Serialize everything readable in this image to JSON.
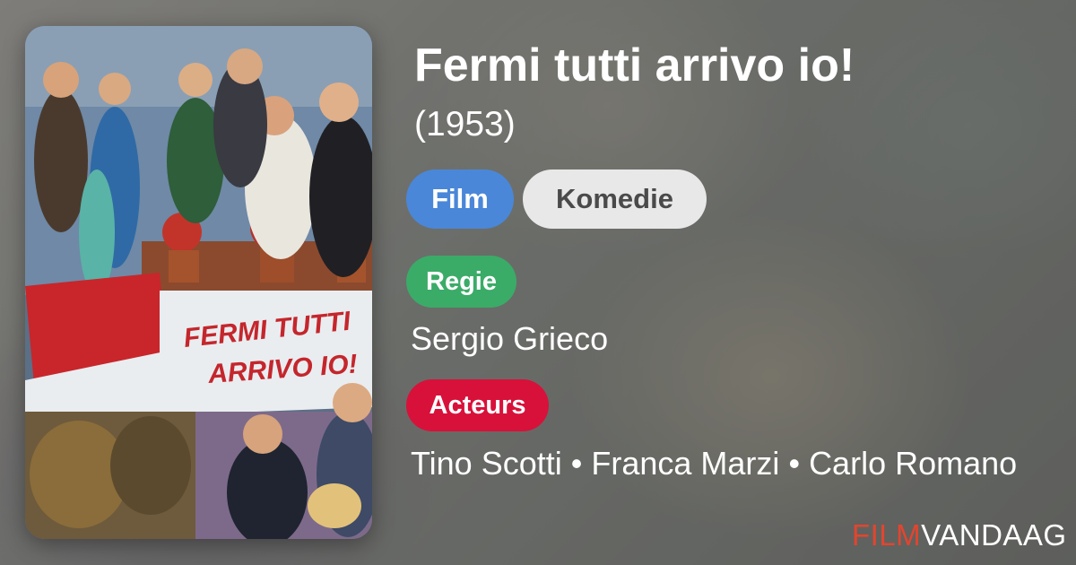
{
  "movie": {
    "title": "Fermi tutti arrivo io!",
    "year": "(1953)",
    "type_label": "Film",
    "genre_label": "Komedie",
    "director_label": "Regie",
    "director_name": "Sergio Grieco",
    "actors_label": "Acteurs",
    "actors": [
      "Tino Scotti",
      "Franca Marzi",
      "Carlo Romano"
    ],
    "separator": "•"
  },
  "poster": {
    "title_line1": "FERMI TUTTI",
    "title_line2": "ARRIVO IO!"
  },
  "brand": {
    "part1": "FILM",
    "part2": "VANDAAG"
  },
  "colors": {
    "type_pill": "#4a87d8",
    "genre_pill": "#e8e8e8",
    "director_tag": "#3bab68",
    "actors_tag": "#d8113a",
    "brand_accent": "#e2452f"
  }
}
